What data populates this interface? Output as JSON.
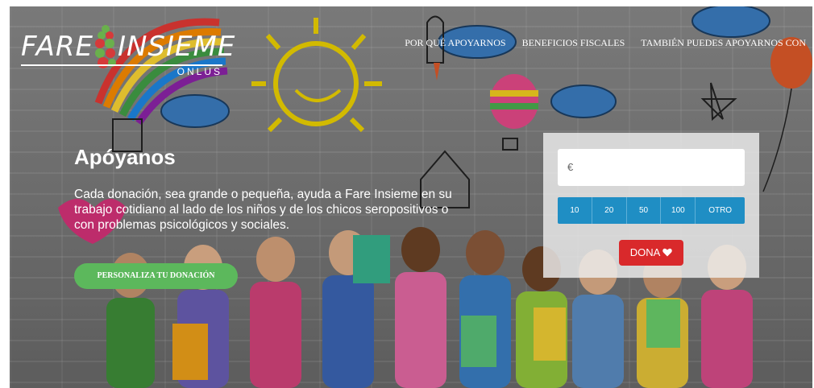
{
  "brand": {
    "name_left": "FARE",
    "name_right": "INSIEME",
    "tagline": "ONLUS"
  },
  "nav": {
    "items": [
      {
        "label": "POR QUÉ APOYARNOS"
      },
      {
        "label": "BENEFICIOS FISCALES"
      },
      {
        "label": "TAMBIÉN PUEDES APOYARNOS CON"
      }
    ]
  },
  "hero": {
    "title": "Apóyanos",
    "text": "Cada donación, sea grande o pequeña, ayuda a Fare Insieme en su trabajo cotidiano al lado de los niños y de los chicos seropositivos o con problemas psicológicos y sociales.",
    "cta": "PERSONALIZA TU DONACIÓN"
  },
  "donation": {
    "currency_symbol": "€",
    "amount_value": "",
    "amounts": [
      "10",
      "20",
      "50",
      "100",
      "OTRO"
    ],
    "donate_label": "DONA",
    "donate_icon": "heart-icon"
  },
  "colors": {
    "green": "#5cb85c",
    "blue": "#1f8ec4",
    "red": "#d9292b"
  }
}
